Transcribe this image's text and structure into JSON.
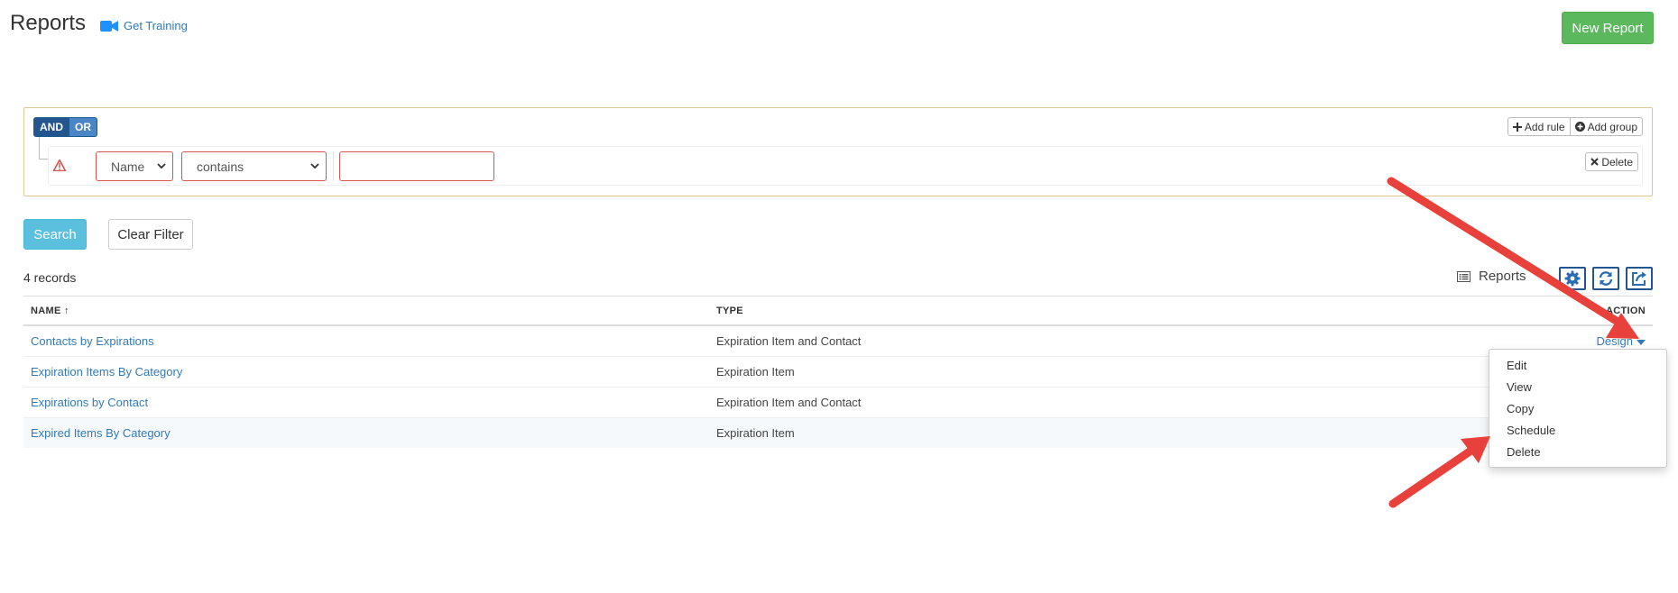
{
  "header": {
    "title": "Reports",
    "training_link": "Get Training",
    "new_report_label": "New Report"
  },
  "query_builder": {
    "and_label": "AND",
    "or_label": "OR",
    "add_rule_label": "Add rule",
    "add_group_label": "Add group",
    "rule": {
      "field_value": "Name",
      "operator_value": "contains",
      "input_value": "",
      "delete_label": "Delete"
    }
  },
  "filters": {
    "search_label": "Search",
    "clear_label": "Clear Filter"
  },
  "toolbar": {
    "records_count": "4 records",
    "view_label": "Reports"
  },
  "table": {
    "columns": [
      "NAME ↑",
      "TYPE",
      "ACTION"
    ],
    "rows": [
      {
        "name": "Contacts by Expirations",
        "type": "Expiration Item and Contact",
        "action": "Design"
      },
      {
        "name": "Expiration Items By Category",
        "type": "Expiration Item",
        "action": ""
      },
      {
        "name": "Expirations by Contact",
        "type": "Expiration Item and Contact",
        "action": ""
      },
      {
        "name": "Expired Items By Category",
        "type": "Expiration Item",
        "action": ""
      }
    ]
  },
  "action_menu": {
    "items": [
      "Edit",
      "View",
      "Copy",
      "Schedule",
      "Delete"
    ]
  },
  "colors": {
    "primary_link": "#337ab7",
    "success": "#5cb85c",
    "info": "#5bc0de",
    "danger": "#d9534f",
    "annotation_arrow": "#e8403a"
  }
}
